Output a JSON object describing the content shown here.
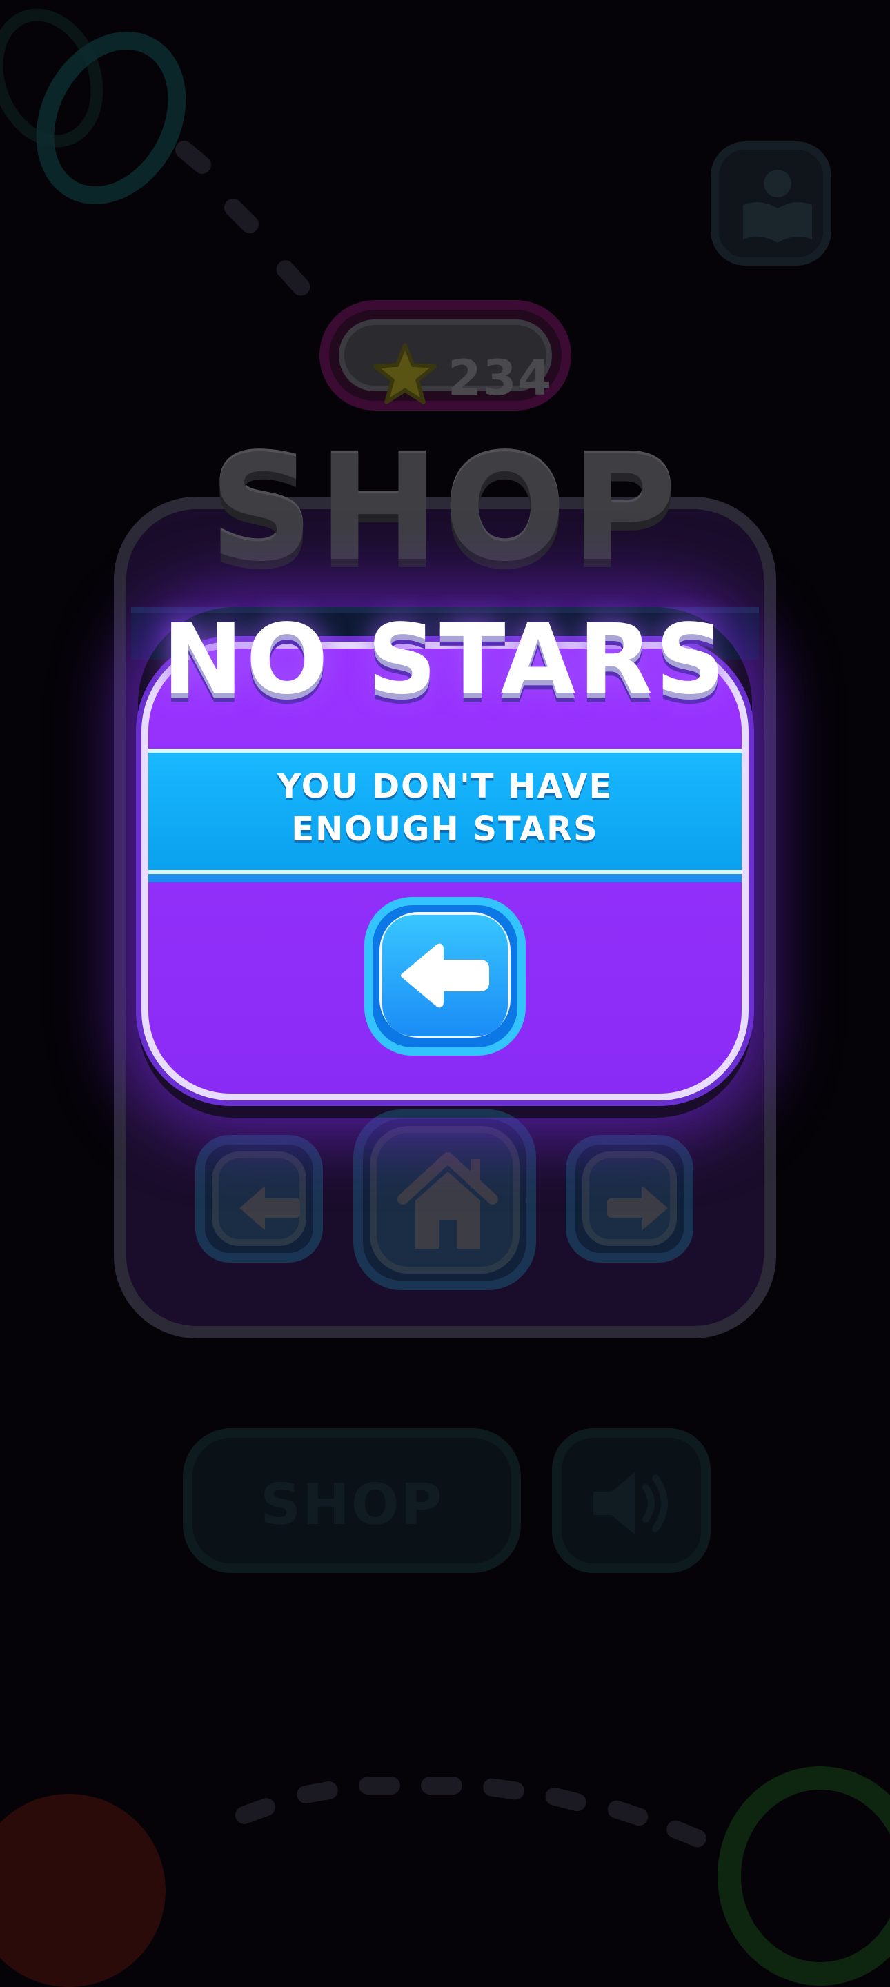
{
  "header": {
    "star_count": "234",
    "shop_title": "SHOP"
  },
  "modal": {
    "title": "NO STARS",
    "message_line1": "YOU DON'T HAVE",
    "message_line2": "ENOUGH STARS",
    "back_icon": "back-arrow-icon"
  },
  "shop_nav": {
    "prev_icon": "left-arrow-icon",
    "home_icon": "home-icon",
    "next_icon": "right-arrow-icon"
  },
  "background": {
    "shop_button_label": "SHOP",
    "sound_icon": "speaker-icon",
    "reader_icon": "reading-person-icon"
  },
  "colors": {
    "modal_purple": "#9a34ff",
    "banner_blue": "#19b8ff",
    "button_blue": "#1a8cf6",
    "overlay": "#050308"
  }
}
